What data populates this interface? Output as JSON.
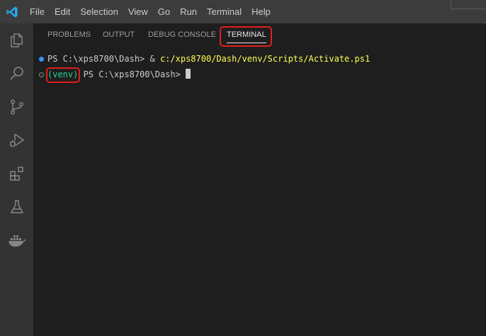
{
  "menu": {
    "items": [
      "File",
      "Edit",
      "Selection",
      "View",
      "Go",
      "Run",
      "Terminal",
      "Help"
    ]
  },
  "activity_bar": {
    "icons": [
      "explorer-icon",
      "search-icon",
      "source-control-icon",
      "run-debug-icon",
      "extensions-icon",
      "testing-icon",
      "docker-icon"
    ]
  },
  "panel": {
    "tabs": [
      {
        "label": "PROBLEMS",
        "active": false
      },
      {
        "label": "OUTPUT",
        "active": false
      },
      {
        "label": "DEBUG CONSOLE",
        "active": false
      },
      {
        "label": "TERMINAL",
        "active": true
      }
    ]
  },
  "terminal": {
    "line1": {
      "prompt": "PS C:\\xps8700\\Dash> ",
      "operator": "& ",
      "command": "c:/xps8700/Dash/venv/Scripts/Activate.ps1"
    },
    "line2": {
      "env": "(venv)",
      "prompt": " PS C:\\xps8700\\Dash> "
    }
  },
  "colors": {
    "accent": "#007acc",
    "highlight": "#e01e1e",
    "command": "#ffff55",
    "venv": "#23d18b"
  }
}
